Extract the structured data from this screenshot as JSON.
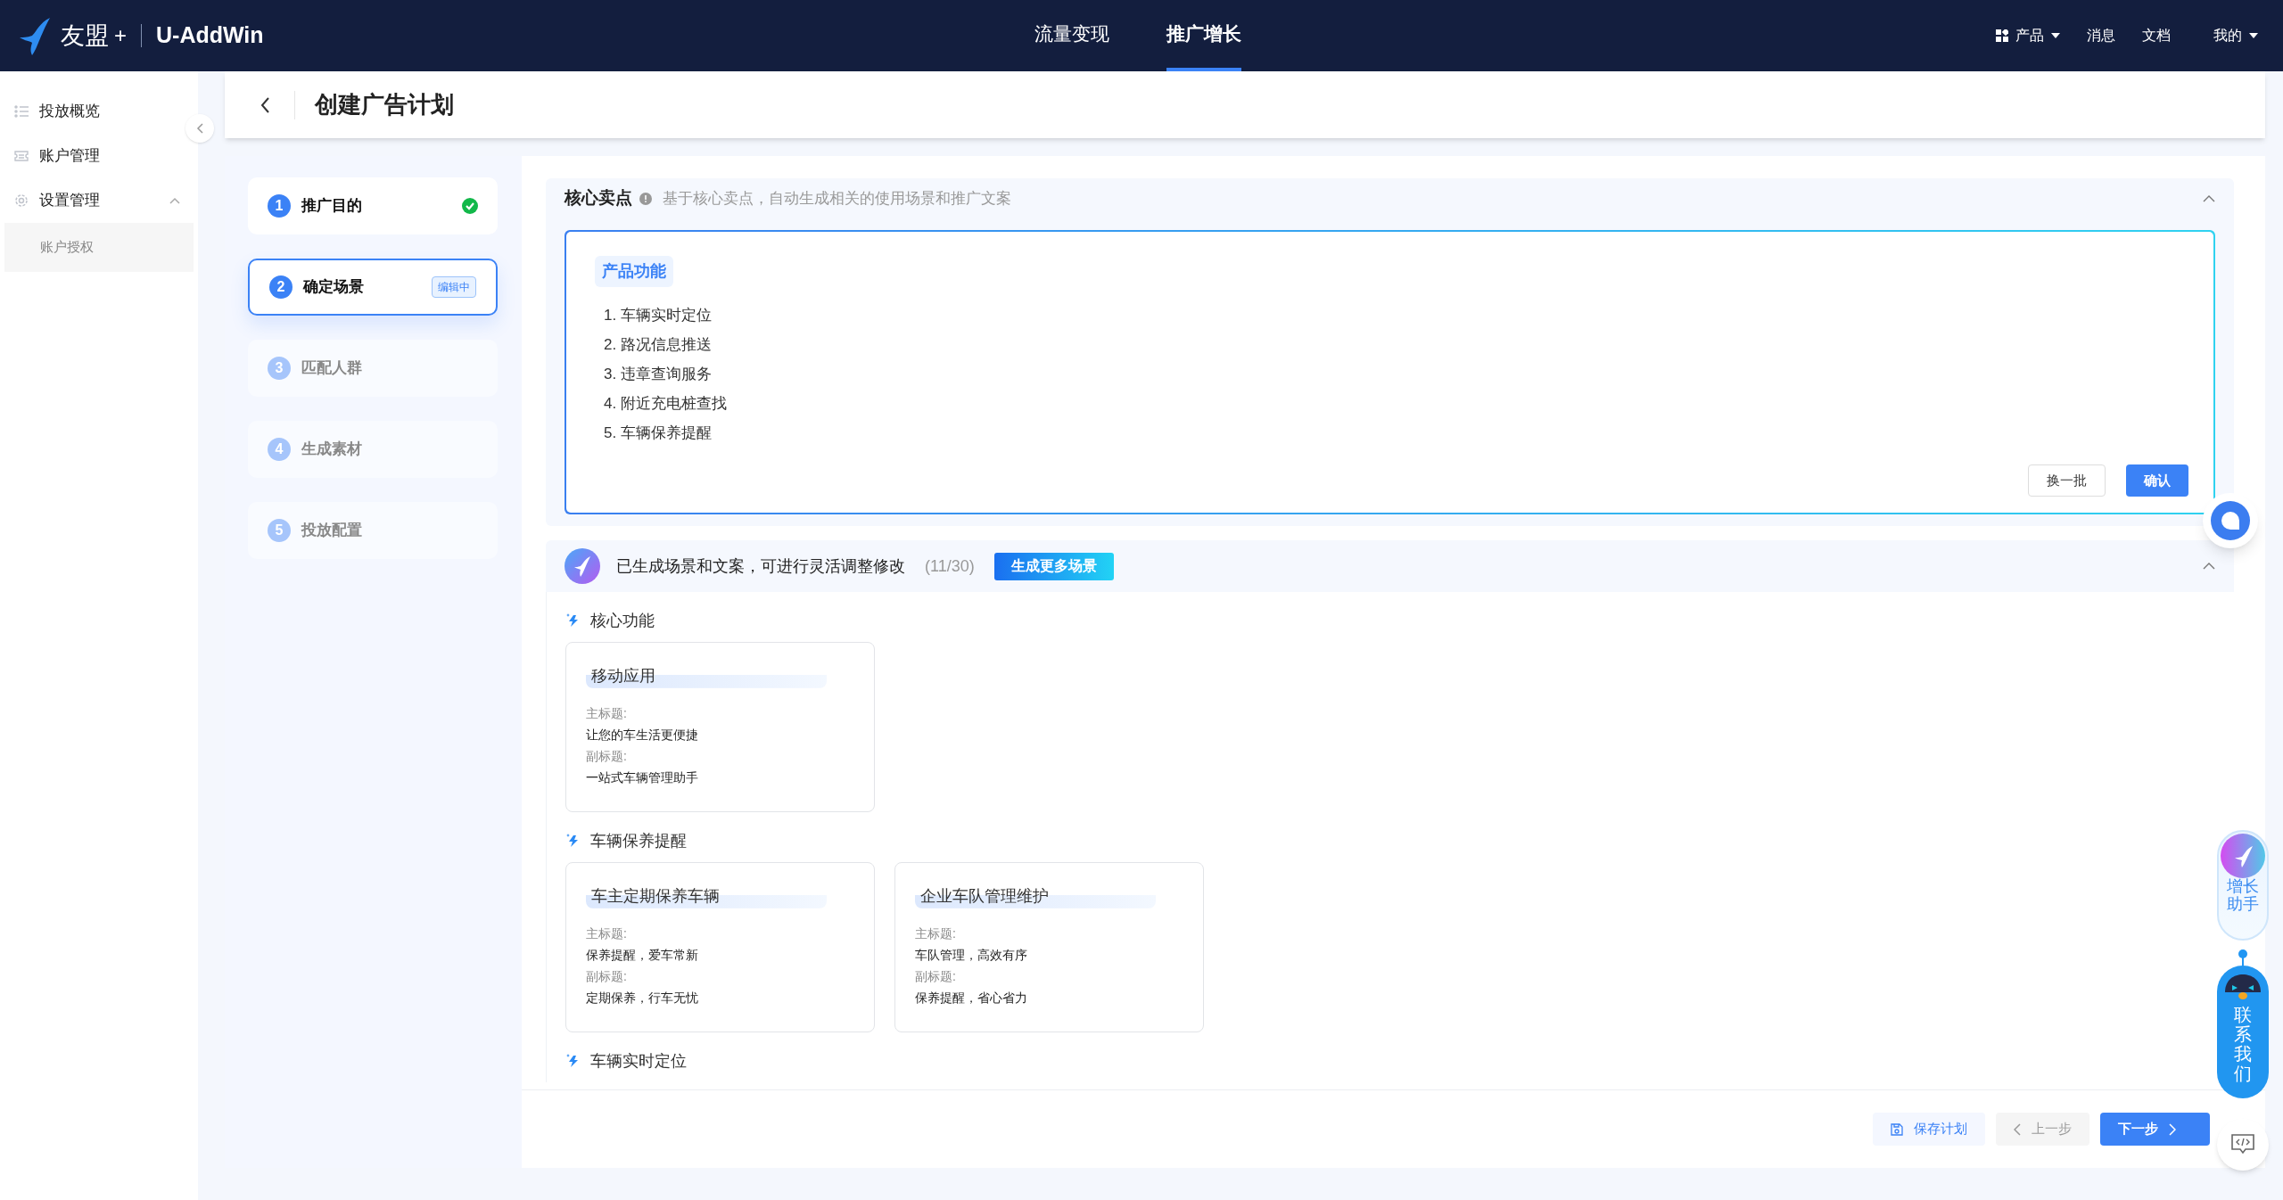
{
  "topbar": {
    "brand": "友盟",
    "brand_plus": "+",
    "product": "U-AddWin",
    "nav": [
      {
        "label": "流量变现",
        "selected": false
      },
      {
        "label": "推广增长",
        "selected": true
      }
    ],
    "menu": [
      {
        "label": "产品",
        "kind": "apps"
      },
      {
        "label": "消息",
        "kind": "link"
      },
      {
        "label": "文档",
        "kind": "link"
      },
      {
        "label": "我的",
        "kind": "dropdown"
      }
    ]
  },
  "sidebar": {
    "items": [
      {
        "label": "投放概览",
        "kind": "list"
      },
      {
        "label": "账户管理",
        "kind": "ticket"
      },
      {
        "label": "设置管理",
        "kind": "gear",
        "expanded": true,
        "children": [
          {
            "label": "账户授权",
            "selected": true
          }
        ]
      }
    ]
  },
  "page_title": "创建广告计划",
  "steps": [
    {
      "number": "1",
      "label": "推广目的",
      "completed": true,
      "selected": false
    },
    {
      "number": "2",
      "label": "确定场景",
      "completed": false,
      "selected": true,
      "badge": "编辑中"
    },
    {
      "number": "3",
      "label": "匹配人群",
      "completed": false,
      "selected": false
    },
    {
      "number": "4",
      "label": "生成素材",
      "completed": false,
      "selected": false
    },
    {
      "number": "5",
      "label": "投放配置",
      "completed": false,
      "selected": false
    }
  ],
  "core_points": {
    "title": "核心卖点",
    "hint": "基于核心卖点，自动生成相关的使用场景和推广文案",
    "expanded": true,
    "tag": "产品功能",
    "items": [
      "1. 车辆实时定位",
      "2. 路况信息推送",
      "3. 违章查询服务",
      "4. 附近充电桩查找",
      "5. 车辆保养提醒"
    ],
    "buttons": [
      {
        "label": "换一批",
        "kind": "secondary"
      },
      {
        "label": "确认",
        "kind": "primary"
      }
    ]
  },
  "scenes": {
    "summary": "已生成场景和文案，可进行灵活调整修改",
    "count": "(11/30)",
    "button": "生成更多场景",
    "expanded": true,
    "groups": [
      {
        "title": "核心功能",
        "cards": [
          {
            "name": "移动应用",
            "main_label": "主标题:",
            "main": "让您的车生活更便捷",
            "sub_label": "副标题:",
            "sub": "一站式车辆管理助手"
          }
        ]
      },
      {
        "title": "车辆保养提醒",
        "cards": [
          {
            "name": "车主定期保养车辆",
            "main_label": "主标题:",
            "main": "保养提醒，爱车常新",
            "sub_label": "副标题:",
            "sub": "定期保养，行车无忧"
          },
          {
            "name": "企业车队管理维护",
            "main_label": "主标题:",
            "main": "车队管理，高效有序",
            "sub_label": "副标题:",
            "sub": "保养提醒，省心省力"
          }
        ]
      },
      {
        "title": "车辆实时定位"
      }
    ]
  },
  "footer": {
    "buttons": [
      {
        "label": "保存计划",
        "kind": "save"
      },
      {
        "label": "上一步",
        "kind": "prev"
      },
      {
        "label": "下一步",
        "kind": "next"
      }
    ]
  },
  "floating": {
    "assistant": "增长助手",
    "contact": "联系我们"
  }
}
